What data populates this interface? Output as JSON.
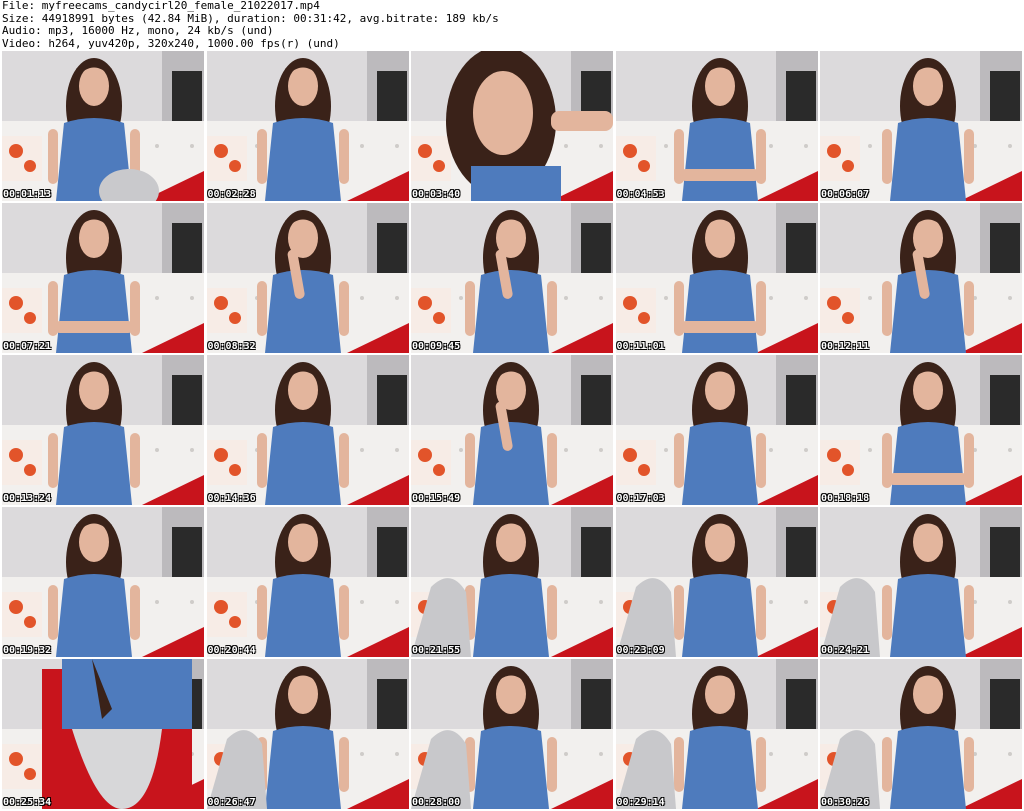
{
  "header": {
    "file_line": "File: myfreecams_candycirl20_female_21022017.mp4",
    "size_line": "Size: 44918991 bytes (42.84 MiB), duration: 00:31:42, avg.bitrate: 189 kb/s",
    "audio_line": "Audio: mp3, 16000 Hz, mono, 24 kb/s (und)",
    "video_line": "Video: h264, yuv420p, 320x240, 1000.00 fps(r) (und)"
  },
  "colors": {
    "shirt": "#4e7bbd",
    "hair": "#3a2219",
    "skin": "#e3b59d",
    "couch": "#f2f0ee",
    "wall": "#dcdadc",
    "pillow_orange": "#e2542a",
    "blanket_red": "#c8141c"
  },
  "thumbnails": [
    {
      "timestamp": "00:01:13",
      "pose": "knee-up"
    },
    {
      "timestamp": "00:02:28",
      "pose": "sitting"
    },
    {
      "timestamp": "00:03:40",
      "pose": "closeup"
    },
    {
      "timestamp": "00:04:53",
      "pose": "arms-crossed"
    },
    {
      "timestamp": "00:06:07",
      "pose": "sitting"
    },
    {
      "timestamp": "00:07:21",
      "pose": "arms-crossed"
    },
    {
      "timestamp": "00:08:32",
      "pose": "hand-face"
    },
    {
      "timestamp": "00:09:45",
      "pose": "hand-face"
    },
    {
      "timestamp": "00:11:01",
      "pose": "arms-crossed"
    },
    {
      "timestamp": "00:12:11",
      "pose": "hand-face"
    },
    {
      "timestamp": "00:13:24",
      "pose": "sitting"
    },
    {
      "timestamp": "00:14:36",
      "pose": "sitting"
    },
    {
      "timestamp": "00:15:49",
      "pose": "hand-face"
    },
    {
      "timestamp": "00:17:03",
      "pose": "sitting"
    },
    {
      "timestamp": "00:18:18",
      "pose": "arms-crossed"
    },
    {
      "timestamp": "00:19:32",
      "pose": "sitting"
    },
    {
      "timestamp": "00:20:44",
      "pose": "sitting"
    },
    {
      "timestamp": "00:21:55",
      "pose": "legs-up"
    },
    {
      "timestamp": "00:23:09",
      "pose": "legs-up"
    },
    {
      "timestamp": "00:24:21",
      "pose": "legs-up"
    },
    {
      "timestamp": "00:25:34",
      "pose": "torso"
    },
    {
      "timestamp": "00:26:47",
      "pose": "legs-up"
    },
    {
      "timestamp": "00:28:00",
      "pose": "legs-up"
    },
    {
      "timestamp": "00:29:14",
      "pose": "legs-up"
    },
    {
      "timestamp": "00:30:26",
      "pose": "legs-up"
    }
  ]
}
